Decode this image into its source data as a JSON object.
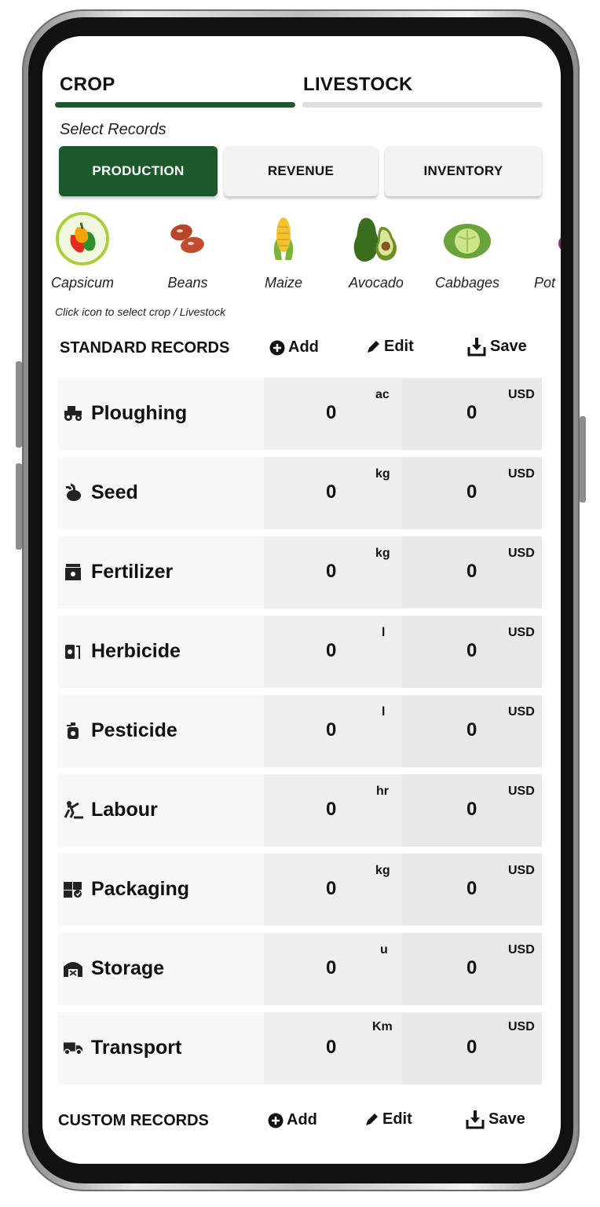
{
  "tabs": [
    {
      "label": "CROP",
      "active": true
    },
    {
      "label": "LIVESTOCK",
      "active": false
    }
  ],
  "select_records_label": "Select Records",
  "record_types": [
    {
      "label": "PRODUCTION",
      "active": true
    },
    {
      "label": "REVENUE",
      "active": false
    },
    {
      "label": "INVENTORY",
      "active": false
    }
  ],
  "crops": [
    {
      "label": "Capsicum",
      "icon": "capsicum-icon",
      "selected": true
    },
    {
      "label": "Beans",
      "icon": "beans-icon"
    },
    {
      "label": "Maize",
      "icon": "maize-icon"
    },
    {
      "label": "Avocado",
      "icon": "avocado-icon"
    },
    {
      "label": "Cabbages",
      "icon": "cabbage-icon"
    },
    {
      "label": "Pot",
      "icon": "potato-icon"
    }
  ],
  "crop_hint": "Click icon to select crop / Livestock",
  "standard_records": {
    "title": "STANDARD RECORDS",
    "add_label": "Add",
    "edit_label": "Edit",
    "save_label": "Save",
    "rows": [
      {
        "label": "Ploughing",
        "icon": "tractor-icon",
        "quantity": "0",
        "unit": "ac",
        "cost": "0",
        "currency": "USD"
      },
      {
        "label": "Seed",
        "icon": "seed-icon",
        "quantity": "0",
        "unit": "kg",
        "cost": "0",
        "currency": "USD"
      },
      {
        "label": "Fertilizer",
        "icon": "fertilizer-icon",
        "quantity": "0",
        "unit": "kg",
        "cost": "0",
        "currency": "USD"
      },
      {
        "label": "Herbicide",
        "icon": "herbicide-icon",
        "quantity": "0",
        "unit": "l",
        "cost": "0",
        "currency": "USD"
      },
      {
        "label": "Pesticide",
        "icon": "pesticide-icon",
        "quantity": "0",
        "unit": "l",
        "cost": "0",
        "currency": "USD"
      },
      {
        "label": "Labour",
        "icon": "labour-icon",
        "quantity": "0",
        "unit": "hr",
        "cost": "0",
        "currency": "USD"
      },
      {
        "label": "Packaging",
        "icon": "packaging-icon",
        "quantity": "0",
        "unit": "kg",
        "cost": "0",
        "currency": "USD"
      },
      {
        "label": "Storage",
        "icon": "storage-icon",
        "quantity": "0",
        "unit": "u",
        "cost": "0",
        "currency": "USD"
      },
      {
        "label": "Transport",
        "icon": "truck-icon",
        "quantity": "0",
        "unit": "Km",
        "cost": "0",
        "currency": "USD"
      }
    ]
  },
  "custom_records": {
    "title": "CUSTOM RECORDS",
    "add_label": "Add",
    "edit_label": "Edit",
    "save_label": "Save"
  },
  "colors": {
    "accent": "#1c5a2e",
    "inactive_bar": "#dedede",
    "selected_ring": "#a8cf38"
  }
}
